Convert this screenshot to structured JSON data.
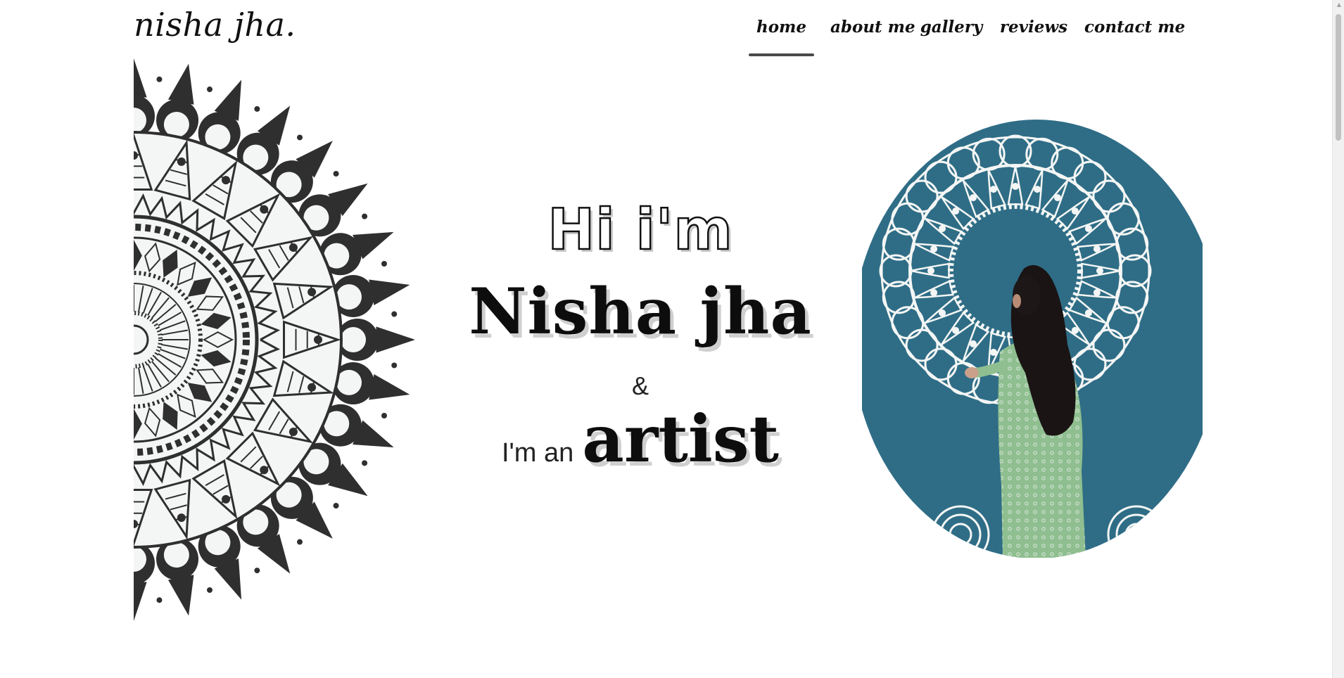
{
  "brand": {
    "logo_text": "nisha jha."
  },
  "nav": {
    "items": [
      {
        "label": "home",
        "active": true
      },
      {
        "label": "about me",
        "active": false
      },
      {
        "label": "gallery",
        "active": false
      },
      {
        "label": "reviews",
        "active": false
      },
      {
        "label": "contact me",
        "active": false
      }
    ]
  },
  "hero": {
    "greeting": "Hi i'm",
    "name": "Nisha jha",
    "ampersand": "&",
    "role_prefix": "I'm an",
    "role": "artist"
  },
  "colors": {
    "background": "#ffffff",
    "text": "#111111",
    "nav_underline": "#4a4a4a",
    "mandala_dark": "#2f2f2f",
    "photo_wall": "#2f6d86",
    "mandala_white": "#f4f6f5",
    "dress_green": "#8fbf90"
  },
  "icons": {
    "mandala_art": "mandala-illustration",
    "artist_photo": "artist-photo"
  }
}
